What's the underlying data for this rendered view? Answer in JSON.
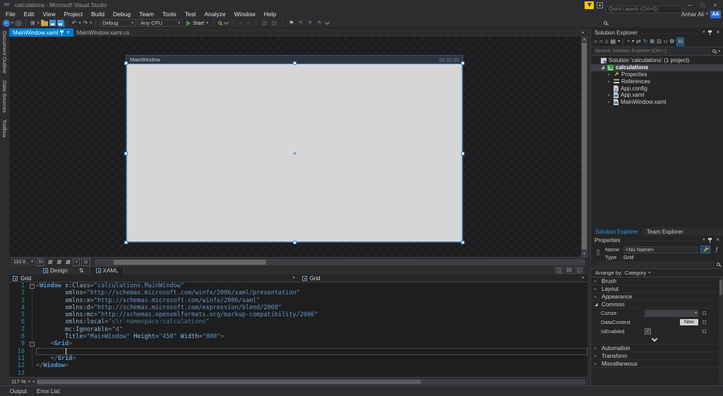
{
  "colors": {
    "accent": "#007ACC",
    "chrome": "#2D2D30",
    "editor_bg": "#1E1E1E",
    "artboard_fill": "#D6D6D6",
    "selection_blue": "#4C8FD0",
    "start_green": "#3A9E3A",
    "folder_gold": "#C8A450",
    "save_blue": "#3A93DD",
    "refresh_blue": "#42A6DC",
    "avatar_blue": "#2D6BCF",
    "notification_yellow": "#FFC800",
    "line_number_teal": "#2B91AF"
  },
  "icons": {
    "dropdown": "▾",
    "back_arrow": "←",
    "forward_arrow": "→",
    "new_project": "⊞",
    "undo": "↶",
    "redo": "↷",
    "minimize": "─",
    "restore": "□",
    "close": "×",
    "expander_collapsed": "▹",
    "expander_expanded": "◢",
    "check": "✓",
    "swap_panes": "⇅",
    "scroll_up": "▴",
    "scroll_down": "▾",
    "split_vertical": "◫",
    "split_horizontal": "⊟",
    "expand_pane": "◱"
  },
  "titlebar": {
    "title": "calculations - Microsoft Visual Studio",
    "quick_launch_placeholder": "Quick Launch (Ctrl+Q)"
  },
  "menubar": {
    "items": [
      "File",
      "Edit",
      "View",
      "Project",
      "Build",
      "Debug",
      "Team",
      "Tools",
      "Test",
      "Analyze",
      "Window",
      "Help"
    ],
    "user_name": "Anhar Ali",
    "user_initials": "AA"
  },
  "toolbar": {
    "solution_configuration": "Debug",
    "solution_platform": "Any CPU",
    "start_label": "Start",
    "extra_icons": [
      {
        "name": "find-in-files-icon",
        "css": "mag"
      },
      {
        "name": "toolbar-overflow-icon",
        "css": "chev"
      },
      {
        "sep": true
      },
      {
        "name": "navigate-backward-editor-icon",
        "glyph": "«",
        "dim": true
      },
      {
        "name": "navigate-forward-editor-icon",
        "glyph": "»",
        "dim": true
      },
      {
        "sep": true
      },
      {
        "name": "comment-selection-icon",
        "glyph": "▧",
        "dim": true
      },
      {
        "name": "uncomment-selection-icon",
        "glyph": "▨",
        "dim": true
      },
      {
        "sep": true
      },
      {
        "name": "bookmark-icon",
        "glyph": "⚑"
      },
      {
        "name": "previous-bookmark-icon",
        "glyph": "⚑",
        "dim": true
      },
      {
        "name": "next-bookmark-icon",
        "glyph": "⚑",
        "dim": true
      },
      {
        "name": "clear-bookmarks-icon",
        "glyph": "⚑",
        "dim": true
      },
      {
        "name": "bookmarks-overflow-icon",
        "css": "chev"
      }
    ]
  },
  "left_rail": {
    "tabs": [
      "Document Outline",
      "Data Sources",
      "Toolbox"
    ]
  },
  "doc_tabs": [
    {
      "label": "MainWindow.xaml",
      "active": true
    },
    {
      "label": "MainWindow.xaml.cs",
      "active": false
    }
  ],
  "designer": {
    "artboard_title": "MainWindow",
    "zoom_value": "110.8...",
    "design_tab": "Design",
    "xaml_tab": "XAML",
    "breadcrumb_left": "Grid",
    "breadcrumb_right": "Grid",
    "zoom_icons": [
      {
        "name": "effects-toggle-icon",
        "glyph": "fx",
        "boxed": true
      },
      {
        "name": "show-grid-icon",
        "glyph": "▦"
      },
      {
        "name": "snap-to-grid-icon",
        "glyph": "▦"
      },
      {
        "name": "show-snap-grid-icon",
        "glyph": "▩"
      },
      {
        "name": "snaplines-toggle-icon",
        "glyph": "+",
        "boxed": true
      },
      {
        "name": "disable-project-code-icon",
        "glyph": "◎",
        "boxed": true
      }
    ]
  },
  "code": {
    "zoom": "117 %",
    "lines": [
      {
        "n": 1,
        "fold": true,
        "tokens": [
          [
            "delim",
            "<"
          ],
          [
            "tag",
            "Window"
          ],
          [
            "attr",
            " x:Class"
          ],
          [
            "op",
            "="
          ],
          [
            "str",
            "\"calculations.MainWindow\""
          ]
        ]
      },
      {
        "n": 2,
        "tokens": [
          [
            "attr",
            "        xmlns"
          ],
          [
            "op",
            "="
          ],
          [
            "str",
            "\"http://schemas.microsoft.com/winfx/2006/xaml/presentation\""
          ]
        ]
      },
      {
        "n": 3,
        "tokens": [
          [
            "attr",
            "        xmlns:x"
          ],
          [
            "op",
            "="
          ],
          [
            "str",
            "\"http://schemas.microsoft.com/winfx/2006/xaml\""
          ]
        ]
      },
      {
        "n": 4,
        "tokens": [
          [
            "attr",
            "        xmlns:d"
          ],
          [
            "op",
            "="
          ],
          [
            "str",
            "\"http://schemas.microsoft.com/expression/blend/2008\""
          ]
        ]
      },
      {
        "n": 5,
        "tokens": [
          [
            "attr",
            "        xmlns:mc"
          ],
          [
            "op",
            "="
          ],
          [
            "str",
            "\"http://schemas.openxmlformats.org/markup-compatibility/2006\""
          ]
        ]
      },
      {
        "n": 6,
        "tokens": [
          [
            "attr",
            "        xmlns:local"
          ],
          [
            "op",
            "="
          ],
          [
            "strdim",
            "\"clr-namespace:calculations\""
          ]
        ]
      },
      {
        "n": 7,
        "tokens": [
          [
            "attr",
            "        mc:Ignorable"
          ],
          [
            "op",
            "="
          ],
          [
            "str",
            "\"d\""
          ]
        ]
      },
      {
        "n": 8,
        "tokens": [
          [
            "attr",
            "        Title"
          ],
          [
            "op",
            "="
          ],
          [
            "str",
            "\"MainWindow\""
          ],
          [
            "attr",
            " Height"
          ],
          [
            "op",
            "="
          ],
          [
            "str",
            "\"450\""
          ],
          [
            "attr",
            " Width"
          ],
          [
            "op",
            "="
          ],
          [
            "str",
            "\"800\""
          ],
          [
            "delim",
            ">"
          ]
        ]
      },
      {
        "n": 9,
        "fold": true,
        "tokens": [
          [
            "delim",
            "    <"
          ],
          [
            "tag",
            "Grid"
          ],
          [
            "delim",
            ">"
          ]
        ]
      },
      {
        "n": 10,
        "caret": true,
        "tokens": [
          [
            "plain",
            "        "
          ]
        ]
      },
      {
        "n": 11,
        "tokens": [
          [
            "delim",
            "    </"
          ],
          [
            "tag",
            "Grid"
          ],
          [
            "delim",
            ">"
          ]
        ]
      },
      {
        "n": 12,
        "tokens": [
          [
            "delim",
            "</"
          ],
          [
            "tag",
            "Window"
          ],
          [
            "delim",
            ">"
          ]
        ]
      },
      {
        "n": 13,
        "tokens": []
      }
    ]
  },
  "solution_explorer": {
    "title": "Solution Explorer",
    "search_placeholder": "Search Solution Explorer (Ctrl+;)",
    "toolbar_icons": [
      {
        "name": "navigate-back-icon",
        "glyph": "○"
      },
      {
        "name": "navigate-forward-icon",
        "glyph": "○"
      },
      {
        "name": "home-icon",
        "glyph": "⌂"
      },
      {
        "name": "switch-views-icon",
        "glyph": "▤"
      },
      {
        "name": "switch-views-dropdown-icon",
        "glyph": "▾",
        "small": true
      },
      {
        "sep": true
      },
      {
        "name": "pending-changes-filter-icon",
        "glyph": "◔"
      },
      {
        "name": "filter-dropdown-icon",
        "glyph": "▾",
        "small": true
      },
      {
        "name": "sync-with-active-document-icon",
        "glyph": "⇄"
      },
      {
        "name": "refresh-icon",
        "glyph": "↻",
        "color": "#42A6DC"
      },
      {
        "name": "nest-related-files-icon",
        "glyph": "⊞"
      },
      {
        "name": "show-all-files-icon",
        "glyph": "⊡"
      },
      {
        "name": "view-code-icon",
        "glyph": "‹›"
      },
      {
        "name": "properties-window-icon",
        "glyph": "⚙"
      },
      {
        "name": "preview-selected-items-icon",
        "glyph": "⊟",
        "active": true
      }
    ],
    "tree": [
      {
        "icon": "solution-icon",
        "label": "Solution 'calculations' (1 project)",
        "indent": 0,
        "expander": "none"
      },
      {
        "icon": "csharp-project-icon",
        "label": "calculations",
        "indent": 1,
        "expander": "expanded",
        "selected": true
      },
      {
        "icon": "wrench-icon",
        "label": "Properties",
        "indent": 2,
        "expander": "collapsed"
      },
      {
        "icon": "references-icon",
        "label": "References",
        "indent": 2,
        "expander": "collapsed"
      },
      {
        "icon": "config-file-icon",
        "label": "App.config",
        "indent": 2,
        "expander": "none"
      },
      {
        "icon": "xaml-file-icon",
        "label": "App.xaml",
        "indent": 2,
        "expander": "collapsed"
      },
      {
        "icon": "xaml-file-icon",
        "label": "MainWindow.xaml",
        "indent": 2,
        "expander": "collapsed"
      }
    ]
  },
  "panel_tabs": [
    {
      "label": "Solution Explorer",
      "active": true
    },
    {
      "label": "Team Explorer",
      "active": false
    }
  ],
  "properties_panel": {
    "title": "Properties",
    "name_label": "Name",
    "name_value": "<No Name>",
    "type_label": "Type",
    "type_value": "Grid",
    "arrange_label": "Arrange by:",
    "arrange_value": "Category",
    "sections": [
      {
        "label": "Brush",
        "state": "collapsed"
      },
      {
        "label": "Layout",
        "state": "collapsed"
      },
      {
        "label": "Appearance",
        "state": "collapsed"
      },
      {
        "label": "Common",
        "state": "expanded",
        "rows": [
          {
            "label": "Cursor",
            "control": "dropdown",
            "value": ""
          },
          {
            "label": "DataContext",
            "control": "button",
            "value": "New"
          },
          {
            "label": "IsEnabled",
            "control": "checkbox",
            "checked": true
          }
        ]
      },
      {
        "label": "Automation",
        "state": "collapsed"
      },
      {
        "label": "Transform",
        "state": "collapsed"
      },
      {
        "label": "Miscellaneous",
        "state": "collapsed"
      }
    ]
  },
  "bottom_tabs": [
    "Output",
    "Error List"
  ]
}
